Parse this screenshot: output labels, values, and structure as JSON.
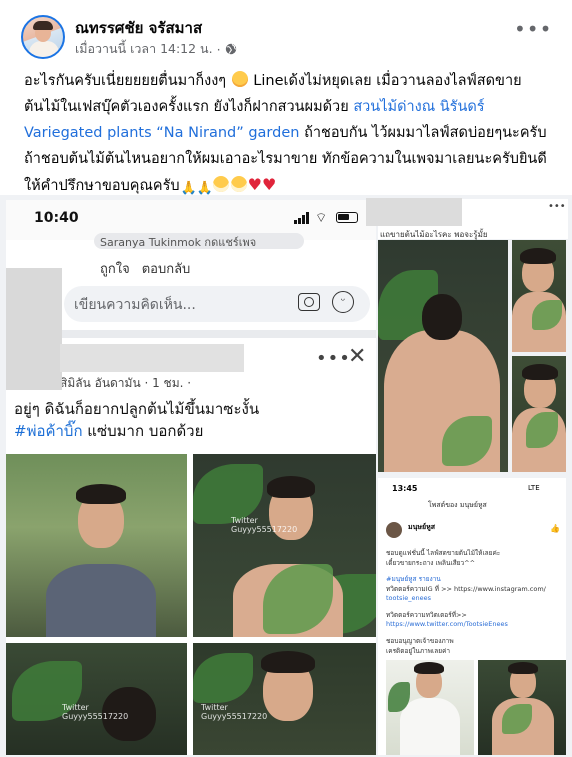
{
  "post": {
    "author": "ณทรรศชัย จรัสมาส",
    "time": "เมื่อวานนี้ เวลา 14:12 น.",
    "separator": "·",
    "caption_part1": "อะไรกันครับเนี่ยยยยยตื่นมาก็งงๆ ",
    "caption_part2": " Lineเด้งไม่หยุดเลย เมื่อวานลองไลฟ์สดขายต้นไม้ในเฟสบุ๊คตัวเองครั้งแรก ยังไงก็ฝากสวนผมด้วย ",
    "caption_link": "สวนไม้ด่างณ นิรันดร์ Variegated plants “Na Nirand” garden",
    "caption_part3": " ถ้าชอบกัน ไว้ผมมาไลฟ์สดบ่อยๆนะครับ ถ้าชอบต้นไม้ต้นไหนอยากให้ผมเอาอะไรมาขาย ทักข้อความในเพจมาเลยนะครับยินดีให้คำปรึกษาขอบคุณครับ"
  },
  "screenshot_left": {
    "clock": "10:40",
    "reply_name": "Saranya Tukinmok กดแชร์เพจ",
    "like_label": "ถูกใจ",
    "reply_label": "ตอบกลับ",
    "comment_placeholder": "เขียนความคิดเห็น...",
    "inner_meta": "สิมิลัน อันดามัน · 1 ชม. · ",
    "inner_text_line1": "อยู่ๆ ดิฉันก็อยากปลูกต้นไม้ขึ้นมาซะงั้น",
    "inner_hashtag": "#พ่อค้าบิ๊ก",
    "inner_text_line2": " แซ่บมาก บอกด้วย",
    "watermark_1": "Twitter Guyyy55517220",
    "watermark_2": "Twitter Guyyy55517220",
    "watermark_3": "Twitter Guyyy55517220",
    "watermark_4": "Twitter Guyyy55517220"
  },
  "screenshot_right": {
    "caption": "แถขายต้นไม้อะไรคะ พอจะรู้มั้ย",
    "clock": "13:45",
    "status": "LTE",
    "title": "โพสต์ของ มนุษย์หูส",
    "name": "มนุษย์หูส",
    "line1": "ชอบดูแฟชั่นนี้ ไลฟ์สดขายต้นไม้ให้เลยค่ะ",
    "line2": "เดี๋ยวขายกระถาง เพลินเสียว^^",
    "line3": "#มนุษย์หูส รายงาน",
    "line4": "ทวิตตอร์ความIG ที่ >> https://www.instagram.com/",
    "line5": "tootsie_enees",
    "line6": "ทวิตตอร์ความทวิตเตอร์ที่>>",
    "line7": "https://www.twitter.com/TootsieEnees",
    "line8": "ชอบอนุญาตเจ้าของภาพ",
    "line9": "เครดิตอยู่ในภาพเลยค่า"
  },
  "colors": {
    "link": "#216fdb",
    "text": "#050505",
    "muted": "#65676b",
    "heart": "#e0243a"
  },
  "icons": [
    "globe-icon",
    "more-icon",
    "signal-icon",
    "wifi-icon",
    "battery-icon",
    "camera-icon",
    "smiley-icon",
    "close-icon"
  ]
}
